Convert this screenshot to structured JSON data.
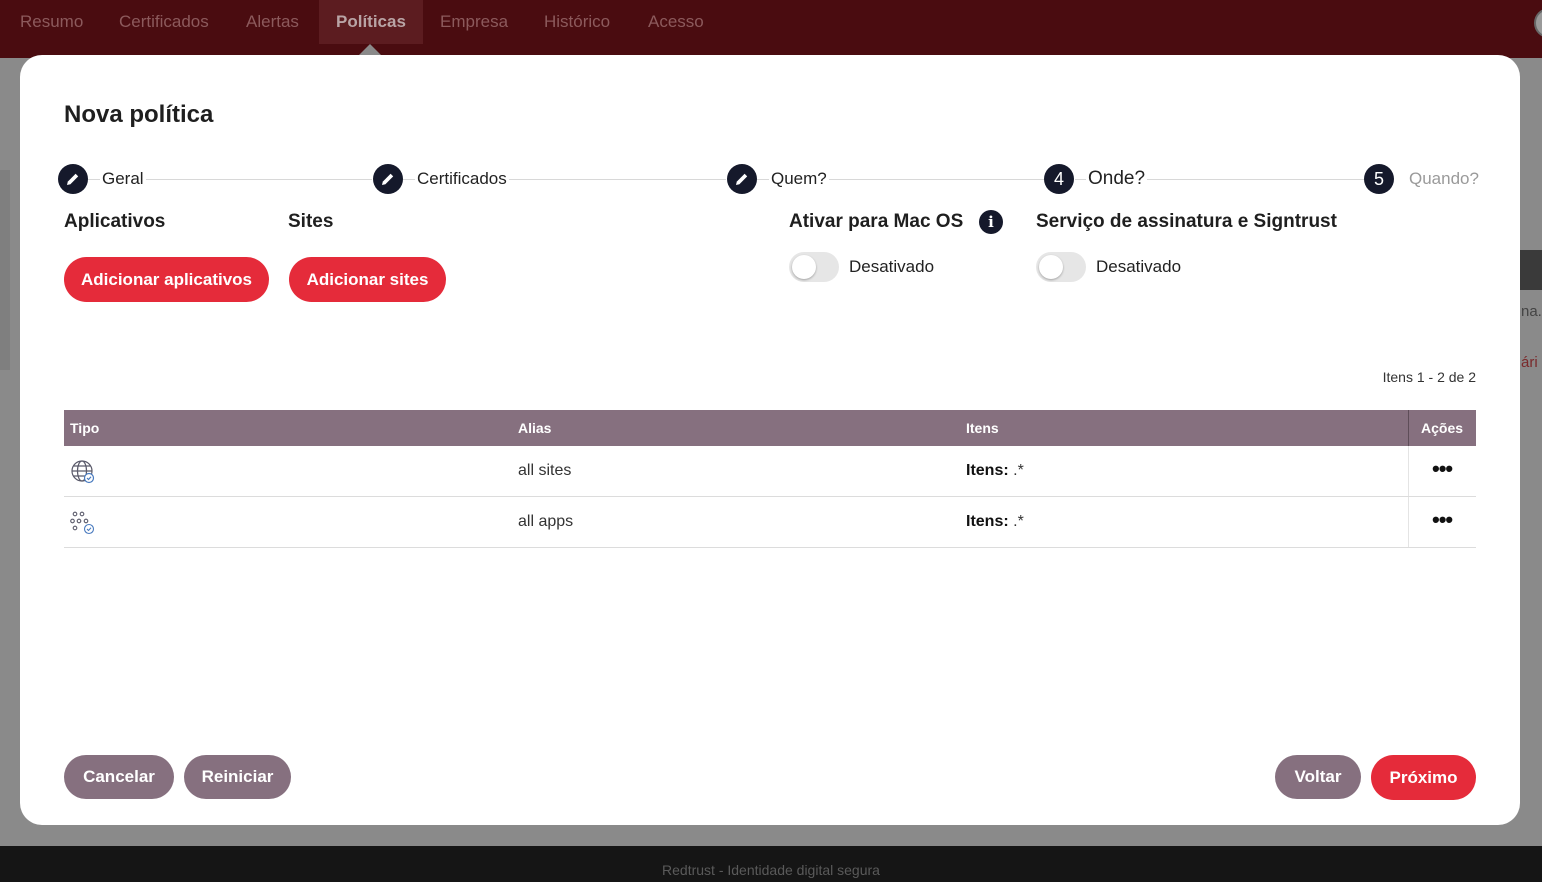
{
  "nav": {
    "items": [
      "Resumo",
      "Certificados",
      "Alertas",
      "Políticas",
      "Empresa",
      "Histórico",
      "Acesso"
    ],
    "active": "Políticas"
  },
  "background": {
    "right_text_1": "na.",
    "right_text_2": "ári"
  },
  "footer": {
    "text": "Redtrust - Identidade digital segura"
  },
  "modal": {
    "title": "Nova política",
    "steps": [
      {
        "label": "Geral",
        "state": "done",
        "icon": "pencil-icon"
      },
      {
        "label": "Certificados",
        "state": "done",
        "icon": "pencil-icon"
      },
      {
        "label": "Quem?",
        "state": "done",
        "icon": "pencil-icon"
      },
      {
        "label": "Onde?",
        "state": "current",
        "number": "4"
      },
      {
        "label": "Quando?",
        "state": "upcoming",
        "number": "5"
      }
    ],
    "apps": {
      "heading": "Aplicativos",
      "button": "Adicionar aplicativos"
    },
    "sites": {
      "heading": "Sites",
      "button": "Adicionar sites"
    },
    "macos": {
      "heading": "Ativar para Mac OS",
      "info_icon": "i",
      "toggle_label": "Desativado",
      "enabled": false
    },
    "signtrust": {
      "heading": "Serviço de assinatura e Signtrust",
      "toggle_label": "Desativado",
      "enabled": false
    },
    "pagination": "Itens 1 - 2 de 2",
    "table": {
      "headers": {
        "type": "Tipo",
        "alias": "Alias",
        "items": "Itens",
        "actions": "Ações"
      },
      "rows": [
        {
          "type_icon": "globe-check-icon",
          "alias": "all sites",
          "items_label": "Itens:",
          "items_value": " .*",
          "actions": "•••"
        },
        {
          "type_icon": "apps-check-icon",
          "alias": "all apps",
          "items_label": "Itens:",
          "items_value": " .*",
          "actions": "•••"
        }
      ]
    },
    "footer_buttons": {
      "cancel": "Cancelar",
      "reset": "Reiniciar",
      "back": "Voltar",
      "next": "Próximo"
    }
  },
  "colors": {
    "primary_red": "#e52b3a",
    "muted_purple": "#86707f",
    "dark_navy": "#15192b",
    "nav_bg": "#4a0c10"
  }
}
